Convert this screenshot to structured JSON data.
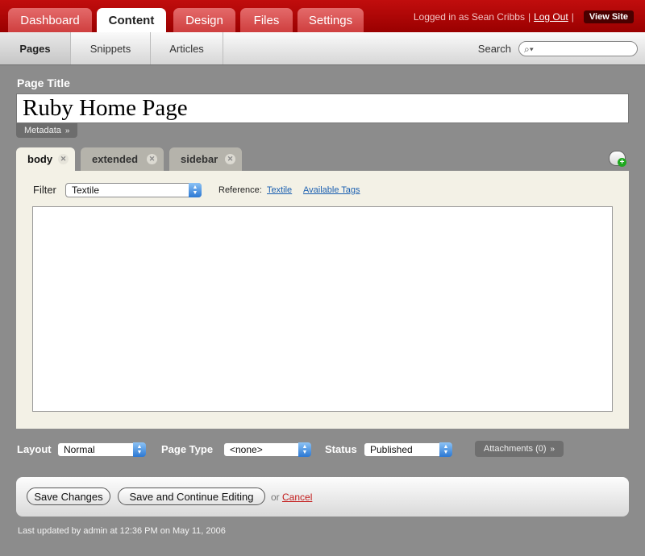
{
  "main_tabs": [
    {
      "label": "Dashboard",
      "active": false
    },
    {
      "label": "Content",
      "active": true
    },
    {
      "label": "Design",
      "active": false
    },
    {
      "label": "Files",
      "active": false
    },
    {
      "label": "Settings",
      "active": false
    }
  ],
  "user": {
    "logged_in_text": "Logged in as Sean Cribbs",
    "separator": "|",
    "logout_label": "Log Out",
    "view_site_label": "View Site"
  },
  "sub_tabs": [
    {
      "label": "Pages",
      "active": true
    },
    {
      "label": "Snippets",
      "active": false
    },
    {
      "label": "Articles",
      "active": false
    }
  ],
  "search": {
    "label": "Search",
    "value": "",
    "placeholder": ""
  },
  "page": {
    "title_label": "Page Title",
    "title_value": "Ruby Home Page",
    "metadata_label": "Metadata"
  },
  "parts": [
    {
      "label": "body",
      "active": true
    },
    {
      "label": "extended",
      "active": false
    },
    {
      "label": "sidebar",
      "active": false
    }
  ],
  "editor": {
    "filter_label": "Filter",
    "filter_value": "Textile",
    "reference_label": "Reference:",
    "reference_links": [
      "Textile",
      "Available Tags"
    ],
    "content": ""
  },
  "controls": {
    "layout_label": "Layout",
    "layout_value": "Normal",
    "page_type_label": "Page Type",
    "page_type_value": "<none>",
    "status_label": "Status",
    "status_value": "Published",
    "attachments_label": "Attachments (0)"
  },
  "actions": {
    "save_label": "Save Changes",
    "save_continue_label": "Save and Continue Editing",
    "or_text": "or",
    "cancel_label": "Cancel"
  },
  "footer": {
    "last_updated": "Last updated by admin at 12:36 PM on May 11, 2006"
  },
  "colors": {
    "brand_red": "#b30000",
    "panel_bg": "#f3f1e6",
    "page_bg": "#8c8c8c",
    "link_blue": "#1a5fb0"
  }
}
